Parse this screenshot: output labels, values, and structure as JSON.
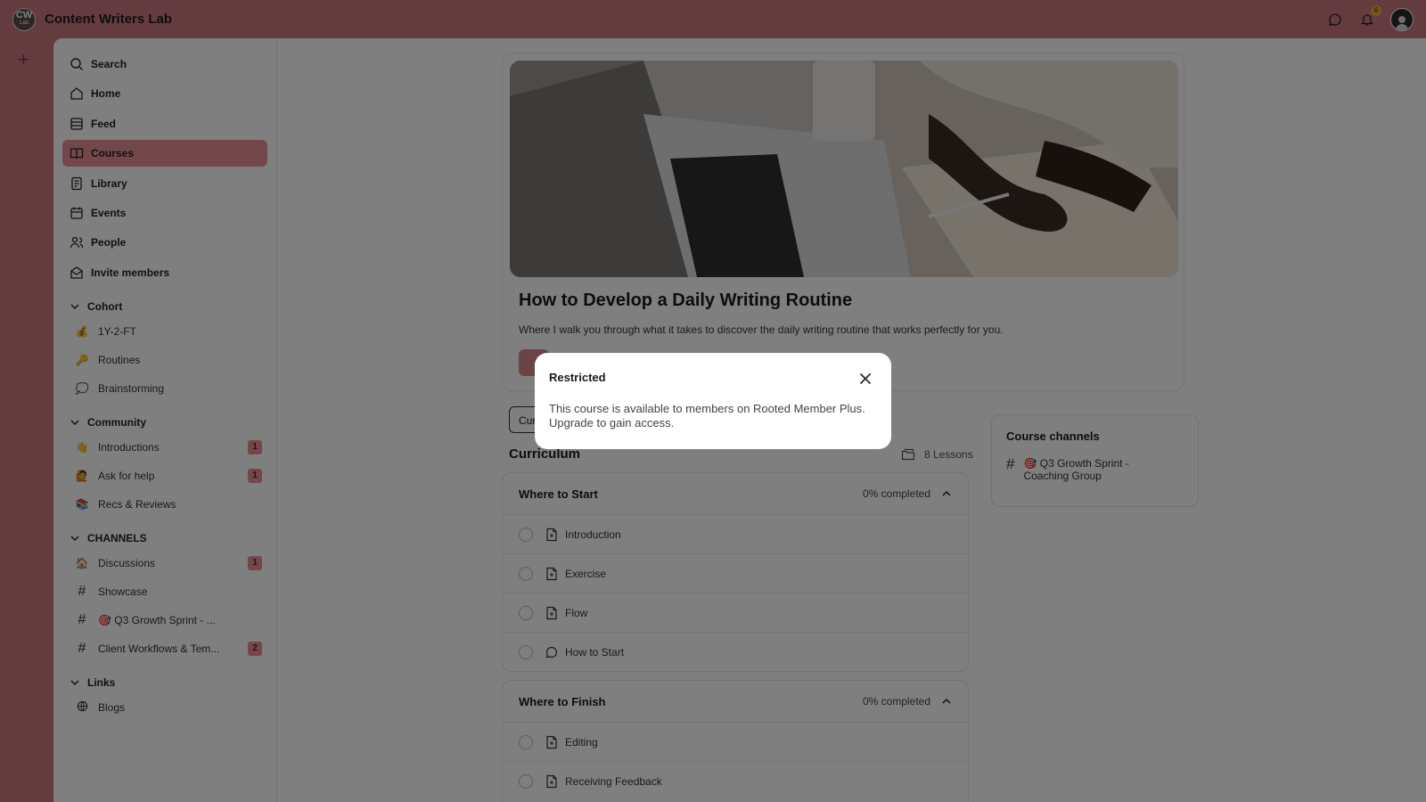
{
  "app": {
    "logo_text": "CW",
    "logo_sub": "Lab",
    "title": "Content Writers Lab",
    "notification_count": "6"
  },
  "sidebar": {
    "nav": [
      {
        "label": "Search",
        "icon": "search-icon"
      },
      {
        "label": "Home",
        "icon": "home-icon"
      },
      {
        "label": "Feed",
        "icon": "feed-icon"
      },
      {
        "label": "Courses",
        "icon": "book-icon",
        "active": true
      },
      {
        "label": "Library",
        "icon": "library-icon"
      },
      {
        "label": "Events",
        "icon": "calendar-icon"
      },
      {
        "label": "People",
        "icon": "people-icon"
      },
      {
        "label": "Invite members",
        "icon": "mail-icon"
      }
    ],
    "sections": {
      "cohort": {
        "label": "Cohort",
        "items": [
          {
            "label": "1Y-2-FT",
            "emoji": "💰"
          },
          {
            "label": "Routines",
            "emoji": "🔑"
          },
          {
            "label": "Brainstorming",
            "emoji": "💭"
          }
        ]
      },
      "community": {
        "label": "Community",
        "items": [
          {
            "label": "Introductions",
            "emoji": "👋",
            "count": "1"
          },
          {
            "label": "Ask for help",
            "emoji": "🙋",
            "count": "1"
          },
          {
            "label": "Recs & Reviews",
            "emoji": "📚"
          }
        ]
      },
      "channels": {
        "label": "CHANNELS",
        "items": [
          {
            "label": "Discussions",
            "emoji": "🏠",
            "count": "1"
          },
          {
            "label": "Showcase",
            "hash": "#"
          },
          {
            "label": "🎯 Q3 Growth Sprint - ...",
            "hash": "#"
          },
          {
            "label": "Client Workflows & Tem...",
            "hash": "#",
            "count": "2"
          }
        ]
      },
      "links": {
        "label": "Links",
        "items": [
          {
            "label": "Blogs",
            "icon": "globe-icon"
          }
        ]
      }
    }
  },
  "course": {
    "title": "How to Develop a Daily Writing Routine",
    "description": "Where I walk you through what it takes to discover the daily writing routine that works perfectly for you.",
    "tab_stub": "Cur",
    "curriculum_label": "Curriculum",
    "lessons_count": "8 Lessons",
    "modules": [
      {
        "name": "Where to Start",
        "progress": "0% completed",
        "lessons": [
          {
            "label": "Introduction",
            "icon": "lesson-icon"
          },
          {
            "label": "Exercise",
            "icon": "lesson-icon"
          },
          {
            "label": "Flow",
            "icon": "lesson-icon"
          },
          {
            "label": "How to Start",
            "icon": "chat-icon"
          }
        ]
      },
      {
        "name": "Where to Finish",
        "progress": "0% completed",
        "lessons": [
          {
            "label": "Editing",
            "icon": "lesson-icon"
          },
          {
            "label": "Receiving Feedback",
            "icon": "lesson-icon"
          }
        ]
      }
    ]
  },
  "channels_card": {
    "title": "Course channels",
    "channel_line1": "🎯 Q3 Growth Sprint -",
    "channel_line2": "Coaching Group"
  },
  "modal": {
    "title": "Restricted",
    "body": "This course is available to members on Rooted Member Plus. Upgrade to gain access."
  }
}
